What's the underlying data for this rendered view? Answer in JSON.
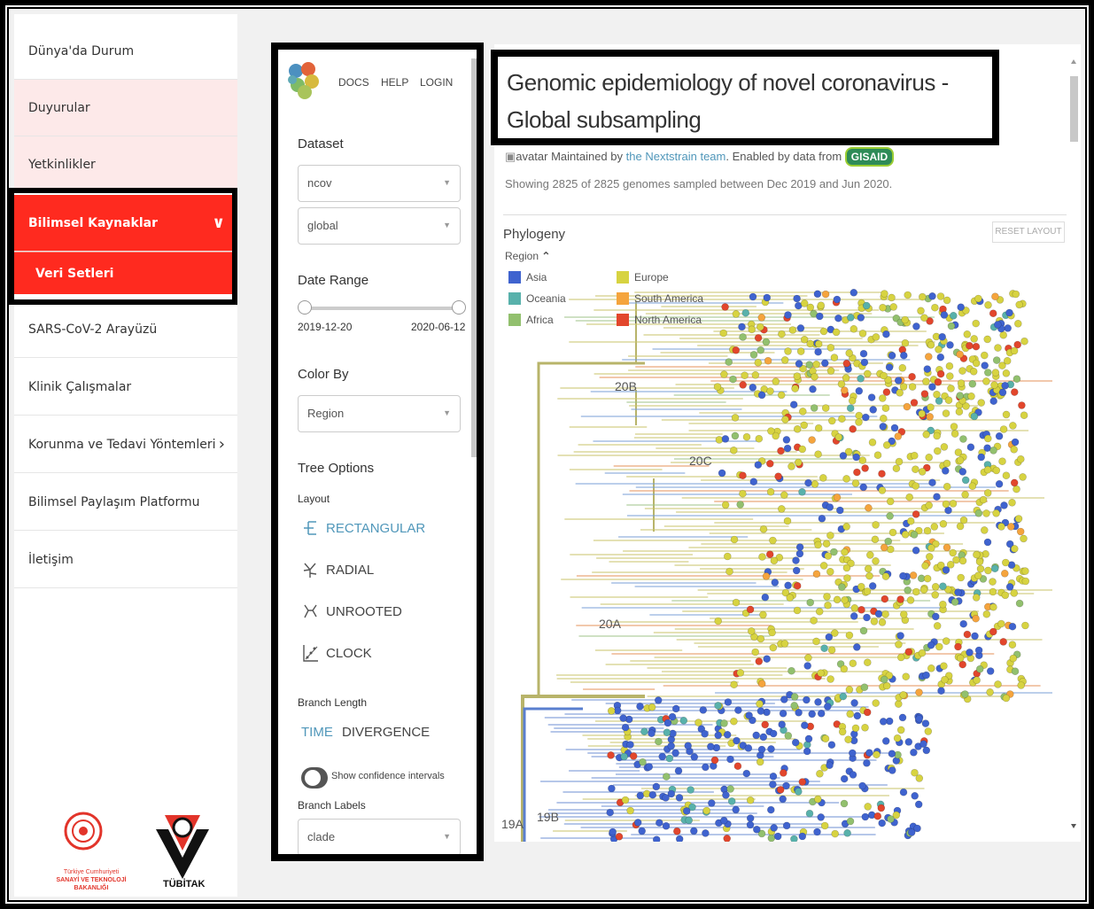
{
  "sidebar": {
    "items": [
      {
        "label": "Dünya'da Durum"
      },
      {
        "label": "Duyurular"
      },
      {
        "label": "Yetkinlikler"
      },
      {
        "label": "Bilimsel Kaynaklar"
      },
      {
        "label": "Veri Setleri"
      },
      {
        "label": "SARS-CoV-2 Arayüzü"
      },
      {
        "label": "Klinik Çalışmalar"
      },
      {
        "label": "Korunma ve Tedavi Yöntemleri"
      },
      {
        "label": "Bilimsel Paylaşım Platformu"
      },
      {
        "label": "İletişim"
      }
    ],
    "logo_ministry_line1": "Türkiye Cumhuriyeti",
    "logo_ministry_line2": "SANAYİ VE TEKNOLOJİ BAKANLIĞI",
    "logo_tubitak": "TÜBİTAK"
  },
  "nextstrain": {
    "nav": {
      "docs": "DOCS",
      "help": "HELP",
      "login": "LOGIN"
    },
    "dataset_label": "Dataset",
    "dataset_value": "ncov",
    "dataset_sub_value": "global",
    "date_range_label": "Date Range",
    "date_start": "2019-12-20",
    "date_end": "2020-06-12",
    "color_by_label": "Color By",
    "color_by_value": "Region",
    "tree_options_label": "Tree Options",
    "layout_label": "Layout",
    "layouts": [
      "RECTANGULAR",
      "RADIAL",
      "UNROOTED",
      "CLOCK"
    ],
    "branch_length_label": "Branch Length",
    "branch_time": "TIME",
    "branch_divergence": "DIVERGENCE",
    "confidence_label": "Show confidence intervals",
    "branch_labels_label": "Branch Labels",
    "branch_labels_value": "clade"
  },
  "main": {
    "title": "Genomic epidemiology of novel coronavirus - Global subsampling",
    "avatar_alt": "avatar",
    "maintained_by": "Maintained by",
    "team_link": "the Nextstrain team",
    "enabled_by": ". Enabled by data from",
    "gisaid": "GISAID",
    "showing": "Showing 2825 of 2825 genomes sampled between Dec 2019 and Jun 2020.",
    "phylogeny_label": "Phylogeny",
    "reset_layout": "RESET LAYOUT",
    "legend_title": "Region",
    "legend": [
      {
        "name": "Asia",
        "color": "#3f63cf"
      },
      {
        "name": "Oceania",
        "color": "#58b1ab"
      },
      {
        "name": "Africa",
        "color": "#92c06e"
      },
      {
        "name": "Europe",
        "color": "#d7d341"
      },
      {
        "name": "South America",
        "color": "#f5a43d"
      },
      {
        "name": "North America",
        "color": "#e2462c"
      }
    ],
    "clades": [
      "20B",
      "20C",
      "20A",
      "19B",
      "19A"
    ]
  },
  "colors": {
    "accent_red": "#ff2a1f",
    "pink": "#fde9e9",
    "link": "#5097ba"
  }
}
